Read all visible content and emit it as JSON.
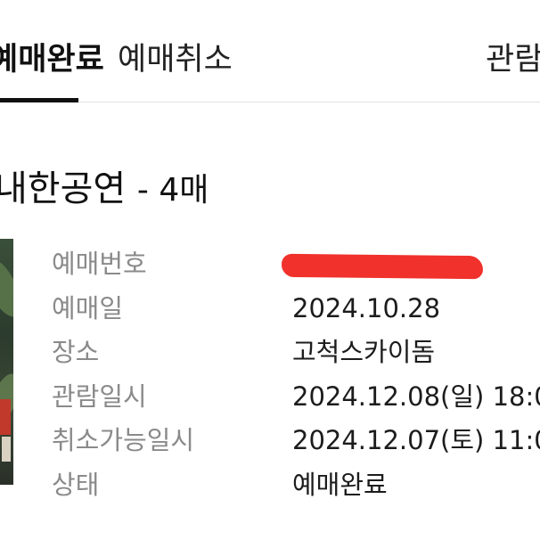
{
  "tabs": {
    "active_label": "예매완료",
    "cancel_label": "예매취소",
    "view_label": "관람"
  },
  "event": {
    "title": "내한공연",
    "ticket_count": "- 4매"
  },
  "details": {
    "rows": [
      {
        "label": "예매번호",
        "value": ""
      },
      {
        "label": "예매일",
        "value": "2024.10.28"
      },
      {
        "label": "장소",
        "value": "고척스카이돔"
      },
      {
        "label": "관람일시",
        "value": "2024.12.08(일) 18:0"
      },
      {
        "label": "취소가능일시",
        "value": "2024.12.07(토) 11:0"
      },
      {
        "label": "상태",
        "value": "예매완료"
      }
    ]
  },
  "colors": {
    "redaction": "#f0312c",
    "label_text": "#8a8a8a",
    "active_tab_underline": "#111111"
  }
}
